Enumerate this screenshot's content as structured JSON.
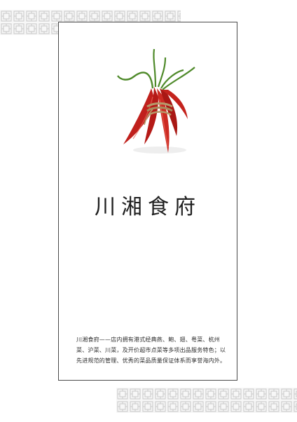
{
  "brand": {
    "name": "川湘食府"
  },
  "description": "川湘食府——店内拥有港式经典燕、鲍、翅、粤菜、杭州菜、沪菜、川菜，及开价超市点菜等多项出品服务特色；以先进规范的管理、优秀的菜品质量保证体系而享誉海内外。",
  "colors": {
    "frame": "#4a4a4a",
    "lattice": "#c9c9c9",
    "chili": "#c0201c",
    "stem": "#4f8a2a",
    "twine": "#b59a6a"
  },
  "icons": {
    "illustration": "chili-bundle-icon",
    "ornament": "lattice-pattern-icon"
  }
}
